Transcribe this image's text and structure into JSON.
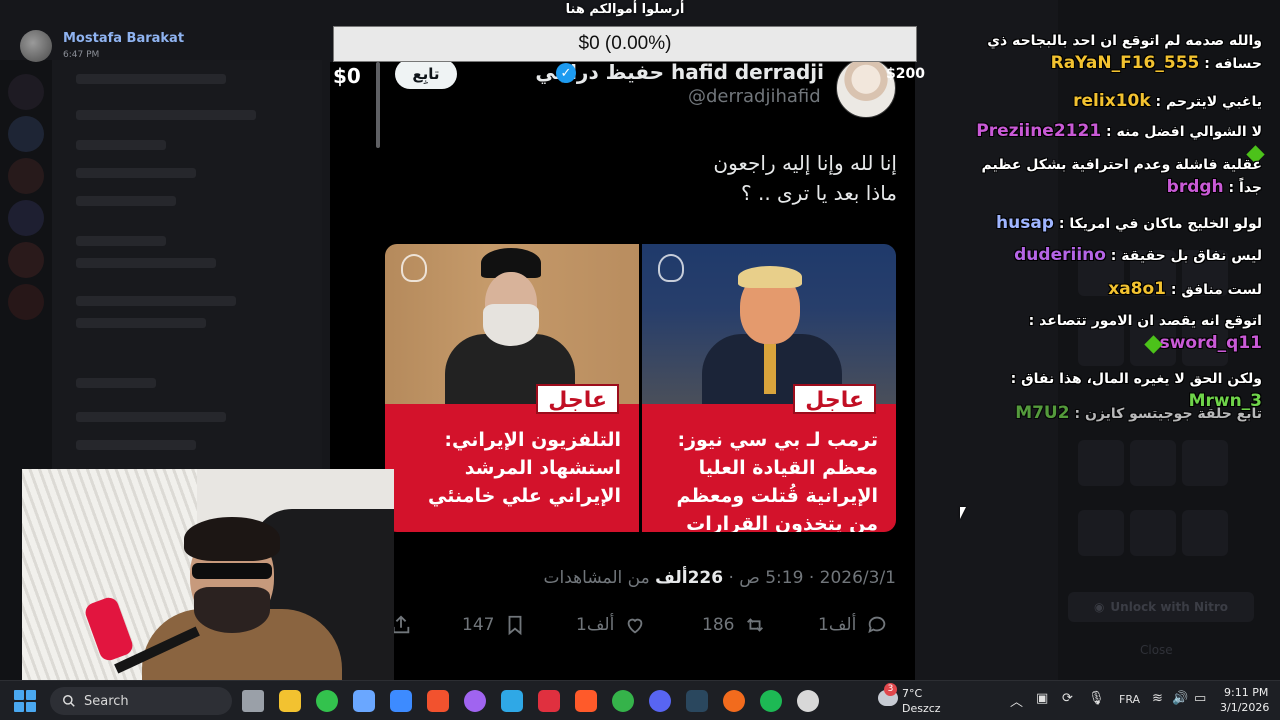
{
  "user": {
    "name": "Mostafa Barakat",
    "time": "6:47 PM"
  },
  "donation": {
    "title": "أرسلوا أموالكم هنا",
    "amount": "$0 (0.00%)",
    "left_amount": "$0",
    "right_amount": "$200",
    "progress_fraction": 0.0
  },
  "tweet": {
    "display_name": "حفيظ دراجي hafid derradji",
    "handle": "@derradjihafid",
    "follow_label": "تابِع",
    "text_line1": "إنا لله وإنا إليه راجعون",
    "text_line2": "ماذا بعد يا ترى .. ؟",
    "card_right": {
      "tag": "عاجل",
      "text": "ترمب لـ بي سي نيوز: معظم القيادة العليا الإيرانية قُتلت ومعظم من يتخذون القرارات رحلوا"
    },
    "card_left": {
      "tag": "عاجل",
      "text": "التلفزيون الإيراني: استشهاد المرشد الإيراني علي خامنئي"
    },
    "views_count": "226ألف",
    "views_label": "من المشاهدات",
    "timestamp": "2026/3/1 · 5:19 ص ·",
    "replies": "1ألف",
    "likes": "1ألف",
    "retweets": "186",
    "bookmarks": "147"
  },
  "chat": [
    {
      "user": "RaYaN_F16_555",
      "color": "#f2c230",
      "text": "والله صدمه لم اتوقع ان احد بالبجاحه ذي حسافه",
      "badge": false
    },
    {
      "user": "relix10k",
      "color": "#f2c230",
      "text": "ياغبي لايترحم",
      "badge": false
    },
    {
      "user": "Preziine2121",
      "color": "#c95ad6",
      "text": "لا الشوالي افضل منه",
      "badge": true
    },
    {
      "user": "brdgh",
      "color": "#c95ad6",
      "text": "عقلية فاشلة وعدم احترافية بشكل عظيم جداً",
      "badge": false
    },
    {
      "user": "husap",
      "color": "#9fb5ff",
      "text": "لولو الخليج ماكان في امريكا",
      "badge": false
    },
    {
      "user": "duderiino",
      "color": "#b565e6",
      "text": "ليس نفاق بل حقيقة",
      "badge": false
    },
    {
      "user": "xa8o1",
      "color": "#f2c230",
      "text": "لست منافق",
      "badge": false
    },
    {
      "user": "sword_q11",
      "color": "#c95ad6",
      "text": "اتوقع انه يقصد ان الامور تتصاعد",
      "badge": true
    },
    {
      "user": "Mrwn_3",
      "color": "#6fd44a",
      "text": "ولكن الحق لا يغيره المال، هذا نفاق",
      "badge": false
    },
    {
      "user": "M7U2",
      "color": "#6fd44a",
      "text": "تابع حلقة جوجيتسو كايزن",
      "badge": false
    }
  ],
  "right_panel": {
    "nitro_label": "Unlock with Nitro",
    "close_label": "Close"
  },
  "taskbar": {
    "search_placeholder": "Search",
    "weather_temp": "7°C",
    "weather_desc": "Deszcz",
    "weather_badge": "3",
    "language": "FRA",
    "time": "9:11 PM",
    "date": "3/1/2026",
    "icons": [
      "file-explorer-icon",
      "files-icon",
      "green-app-icon",
      "copilot-icon",
      "store-icon",
      "red-app-icon",
      "purple-app-icon",
      "edge-icon",
      "red-square-app-icon",
      "brave-icon",
      "green-leaf-icon",
      "discord-icon",
      "steam-icon",
      "orange-app-icon",
      "spotify-icon",
      "chatgpt-icon"
    ]
  },
  "colors": {
    "accent": "#1d9bf0",
    "breaking_red": "#d3122b",
    "taskbar": "#1d1f24"
  }
}
